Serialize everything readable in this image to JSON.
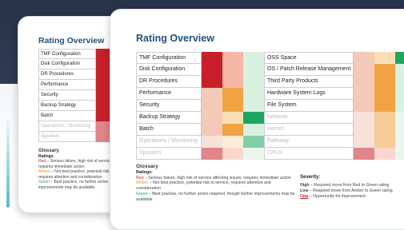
{
  "colors": {
    "navy": "#273348",
    "red": "#c8202a",
    "amber": "#f0a343",
    "green": "#1ea55f",
    "accent_title": "#24507a"
  },
  "back_card": {
    "title": "Rating Overview",
    "rows": [
      {
        "label": "TMF Configuration",
        "rating": "red",
        "faded": false
      },
      {
        "label": "Disk Configuration",
        "rating": "red",
        "faded": false
      },
      {
        "label": "DR Procedures",
        "rating": "red",
        "faded": false
      },
      {
        "label": "Performance",
        "rating": "red",
        "faded": false
      },
      {
        "label": "Security",
        "rating": "red",
        "faded": false
      },
      {
        "label": "Backup Strategy",
        "rating": "red",
        "faded": false
      },
      {
        "label": "Batch",
        "rating": "red",
        "faded": false
      },
      {
        "label": "Operations / Monitoring",
        "rating": "red",
        "faded": true
      },
      {
        "label": "Spoolers",
        "rating": "red",
        "faded": true
      }
    ],
    "glossary": {
      "title": "Glossary",
      "ratings_heading": "Ratings:",
      "red_label": "Red",
      "red_text": " – Serious failure, high risk of service affecting issues, requires immediate action",
      "amber_label": "Amber",
      "amber_text": " – Not best practice, potential risk to service, requires attention and consideration",
      "green_label": "Green",
      "green_text": " – Best practice, no further action required, further improvements may be available"
    }
  },
  "front_card": {
    "title": "Rating Overview",
    "left_rows": [
      {
        "label": "TMF Configuration",
        "rating": "red",
        "faded": false
      },
      {
        "label": "Disk Configuration",
        "rating": "red",
        "faded": false
      },
      {
        "label": "DR Procedures",
        "rating": "red",
        "faded": false
      },
      {
        "label": "Performance",
        "rating": "amber",
        "faded": false
      },
      {
        "label": "Security",
        "rating": "amber",
        "faded": false
      },
      {
        "label": "Backup Strategy",
        "rating": "green",
        "faded": false
      },
      {
        "label": "Batch",
        "rating": "amber",
        "faded": false
      },
      {
        "label": "Operations / Monitoring",
        "rating": "green",
        "faded": true
      },
      {
        "label": "Spoolers",
        "rating": "red",
        "faded": true
      }
    ],
    "right_rows": [
      {
        "label": "OSS Space",
        "rating": "green",
        "faded": false
      },
      {
        "label": "OS / Patch Release Management",
        "rating": "amber",
        "faded": false
      },
      {
        "label": "Third Party Products",
        "rating": "amber",
        "faded": false
      },
      {
        "label": "Hardware System Logs",
        "rating": "amber",
        "faded": false
      },
      {
        "label": "File System",
        "rating": "amber",
        "faded": false
      },
      {
        "label": "Network",
        "rating": "amber",
        "faded": true
      },
      {
        "label": "Kernel",
        "rating": "amber",
        "faded": true
      },
      {
        "label": "Pathway",
        "rating": "amber",
        "faded": true
      },
      {
        "label": "CPUs",
        "rating": "red",
        "faded": true
      }
    ],
    "glossary": {
      "title": "Glossary",
      "ratings_heading": "Ratings:",
      "red_label": "Red",
      "red_text": " – Serious failure, high risk of service affecting issues, requires immediate action",
      "amber_label": "Amber",
      "amber_text": " – Not best practice, potential risk to service, requires attention and consideration",
      "green_label": "Green",
      "green_text": " – Best practice, no further action required, though further improvements may be available"
    },
    "severity": {
      "heading": "Severity:",
      "high_label": "High",
      "high_text": " – Required move from Red to Green rating",
      "low_label": "Low",
      "low_text": " – Required move from Amber to Green rating",
      "opp_label": "Opp",
      "opp_text": " – Opportunity for improvement."
    }
  }
}
